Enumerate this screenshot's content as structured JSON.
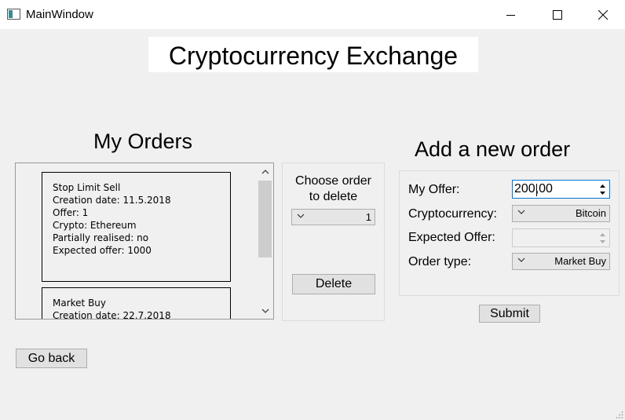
{
  "window": {
    "title": "MainWindow"
  },
  "header": {
    "title": "Cryptocurrency Exchange"
  },
  "orders": {
    "heading": "My Orders",
    "items": [
      {
        "lines": [
          "Stop Limit Sell",
          "Creation date: 11.5.2018",
          "Offer: 1",
          "Crypto: Ethereum",
          "Partially realised: no",
          "Expected offer: 1000"
        ]
      },
      {
        "lines": [
          "Market Buy",
          "Creation date: 22.7.2018"
        ]
      }
    ]
  },
  "delete_panel": {
    "label_line1": "Choose order",
    "label_line2": "to delete",
    "selected_order": "1",
    "delete_label": "Delete"
  },
  "new_order": {
    "heading": "Add a new order",
    "my_offer_label": "My Offer:",
    "my_offer_value": "200,00",
    "crypto_label": "Cryptocurrency:",
    "crypto_value": "Bitcoin",
    "expected_label": "Expected Offer:",
    "expected_value": "",
    "type_label": "Order type:",
    "type_value": "Market Buy",
    "submit_label": "Submit"
  },
  "footer": {
    "go_back_label": "Go back"
  },
  "icons": {
    "app": "app-window-icon",
    "minimize": "minimize-icon",
    "maximize": "maximize-icon",
    "close": "close-icon",
    "scroll_up": "chevron-up-icon",
    "scroll_down": "chevron-down-icon",
    "combo": "chevron-down-icon",
    "spin_up": "spin-up-icon",
    "spin_down": "spin-down-icon",
    "grip": "resize-grip-icon"
  },
  "colors": {
    "focus": "#0078d7",
    "background": "#f0f0f0",
    "button": "#e1e1e1"
  }
}
